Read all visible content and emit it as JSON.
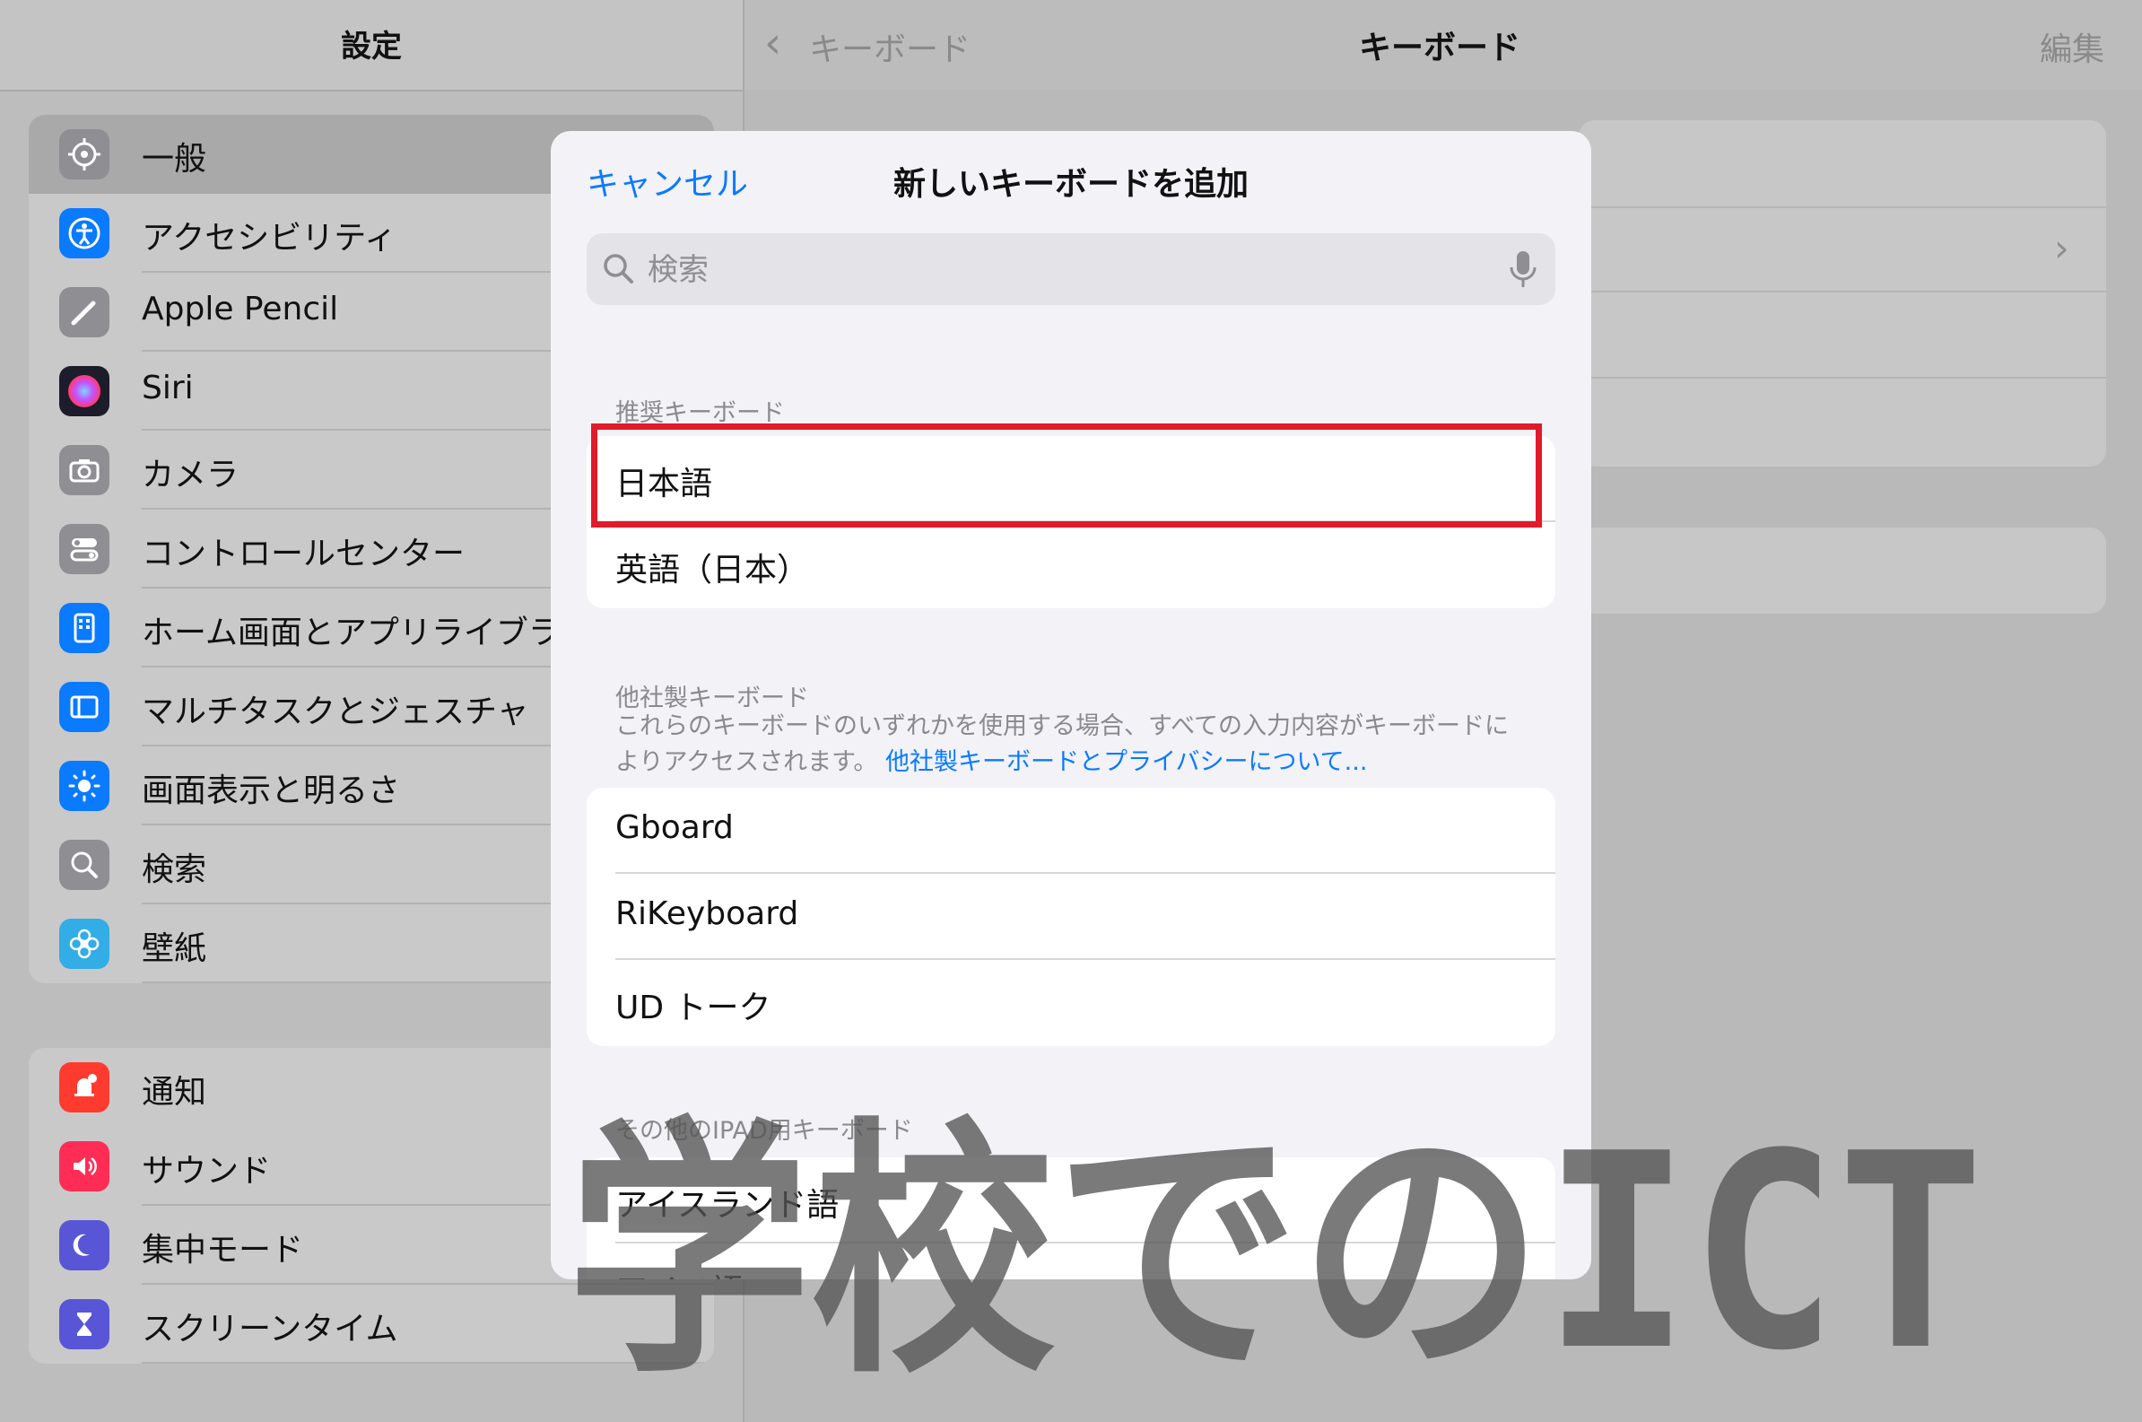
{
  "sidebar": {
    "title": "設定",
    "groups": [
      {
        "items": [
          {
            "label": "一般",
            "icon": "gear-icon",
            "color": "#8e8e93",
            "selected": true
          },
          {
            "label": "アクセシビリティ",
            "icon": "accessibility-icon",
            "color": "#0a7aff"
          },
          {
            "label": "Apple Pencil",
            "icon": "pencil-icon",
            "color": "#8e8e93"
          },
          {
            "label": "Siri",
            "icon": "siri-icon",
            "color": "#222222"
          },
          {
            "label": "カメラ",
            "icon": "camera-icon",
            "color": "#8e8e93"
          },
          {
            "label": "コントロールセンター",
            "icon": "toggles-icon",
            "color": "#8e8e93"
          },
          {
            "label": "ホーム画面とアプリライブラ",
            "icon": "home-screen-icon",
            "color": "#0a7aff"
          },
          {
            "label": "マルチタスクとジェスチャ",
            "icon": "multitask-icon",
            "color": "#0a7aff"
          },
          {
            "label": "画面表示と明るさ",
            "icon": "brightness-icon",
            "color": "#0a7aff"
          },
          {
            "label": "検索",
            "icon": "search-icon",
            "color": "#8e8e93"
          },
          {
            "label": "壁紙",
            "icon": "wallpaper-icon",
            "color": "#32ade6"
          }
        ]
      },
      {
        "items": [
          {
            "label": "通知",
            "icon": "bell-icon",
            "color": "#ff3b30"
          },
          {
            "label": "サウンド",
            "icon": "speaker-icon",
            "color": "#ff2d55"
          },
          {
            "label": "集中モード",
            "icon": "moon-icon",
            "color": "#5856d6"
          },
          {
            "label": "スクリーンタイム",
            "icon": "hourglass-icon",
            "color": "#5856d6"
          }
        ]
      }
    ]
  },
  "detail": {
    "back_label": "キーボード",
    "title": "キーボード",
    "edit_label": "編集"
  },
  "modal": {
    "cancel_label": "キャンセル",
    "title": "新しいキーボードを追加",
    "search": {
      "placeholder": "検索",
      "value": ""
    },
    "suggested": {
      "header": "推奨キーボード",
      "items": [
        "日本語",
        "英語（日本）"
      ]
    },
    "third_party": {
      "header": "他社製キーボード",
      "footer_text": "これらのキーボードのいずれかを使用する場合、すべての入力内容がキーボードによりアクセスされます。",
      "footer_link": "他社製キーボードとプライバシーについて...",
      "items": [
        "Gboard",
        "RiKeyboard",
        "UD トーク"
      ]
    },
    "other": {
      "header": "その他のIPAD用キーボード",
      "items": [
        "アイスランド語",
        "アイヌ語"
      ]
    }
  },
  "watermark": {
    "text": "学校でのICT"
  },
  "colors": {
    "accent": "#0a7aff",
    "highlight": "#e01b2a"
  }
}
